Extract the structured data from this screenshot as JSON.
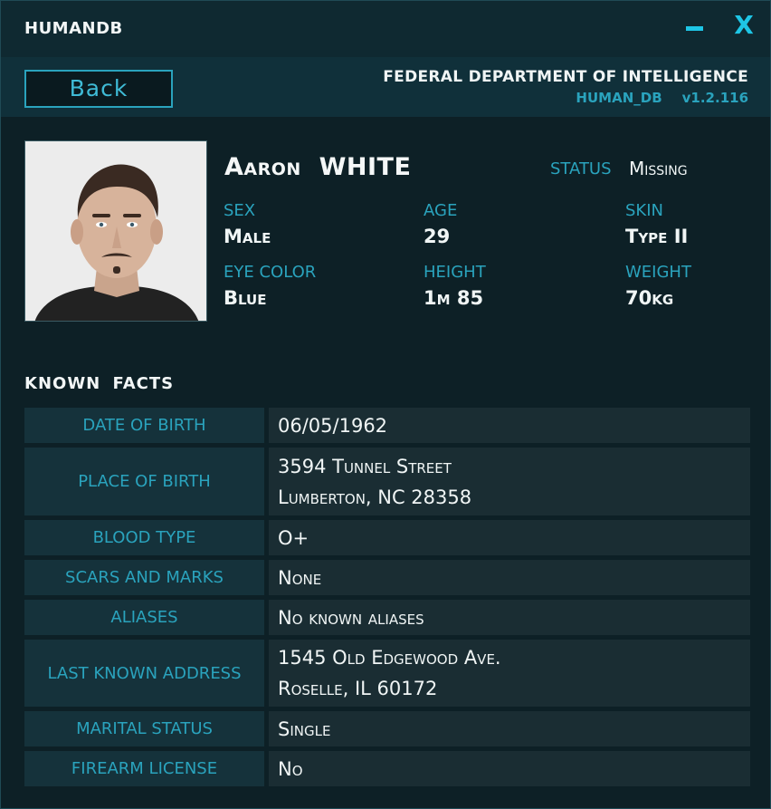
{
  "window": {
    "title": "HUMANDB",
    "minimize_glyph": "",
    "close_glyph": "X"
  },
  "header": {
    "back_label": "Back",
    "agency": "FEDERAL DEPARTMENT OF INTELLIGENCE",
    "db_name": "HUMAN_DB",
    "version": "v1.2.116"
  },
  "profile": {
    "first_name": "Aaron",
    "last_name": "WHITE",
    "status_label": "STATUS",
    "status_value": "Missing",
    "attributes": [
      {
        "label": "SEX",
        "value": "Male"
      },
      {
        "label": "AGE",
        "value": "29"
      },
      {
        "label": "SKIN",
        "value": "Type II"
      },
      {
        "label": "EYE COLOR",
        "value": "Blue"
      },
      {
        "label": "HEIGHT",
        "value": "1m 85"
      },
      {
        "label": "WEIGHT",
        "value": "70kg"
      }
    ]
  },
  "facts": {
    "title": "KNOWN FACTS",
    "rows": [
      {
        "label": "DATE OF BIRTH",
        "lines": [
          "06/05/1962"
        ]
      },
      {
        "label": "PLACE OF BIRTH",
        "lines": [
          "3594 Tunnel Street",
          "Lumberton, NC 28358"
        ]
      },
      {
        "label": "BLOOD TYPE",
        "lines": [
          "O+"
        ]
      },
      {
        "label": "SCARS AND MARKS",
        "lines": [
          "None"
        ]
      },
      {
        "label": "ALIASES",
        "lines": [
          "No known aliases"
        ]
      },
      {
        "label": "LAST KNOWN ADDRESS",
        "lines": [
          "1545 Old Edgewood Ave.",
          "Roselle, IL 60172"
        ]
      },
      {
        "label": "MARITAL STATUS",
        "lines": [
          "Single"
        ]
      },
      {
        "label": "FIREARM LICENSE",
        "lines": [
          "No"
        ]
      }
    ]
  },
  "colors": {
    "accent": "#2aa3bd",
    "window_control": "#1ec6e6",
    "background": "#0d2026"
  },
  "icons": {
    "minimize": "minimize-icon",
    "close": "close-icon"
  }
}
